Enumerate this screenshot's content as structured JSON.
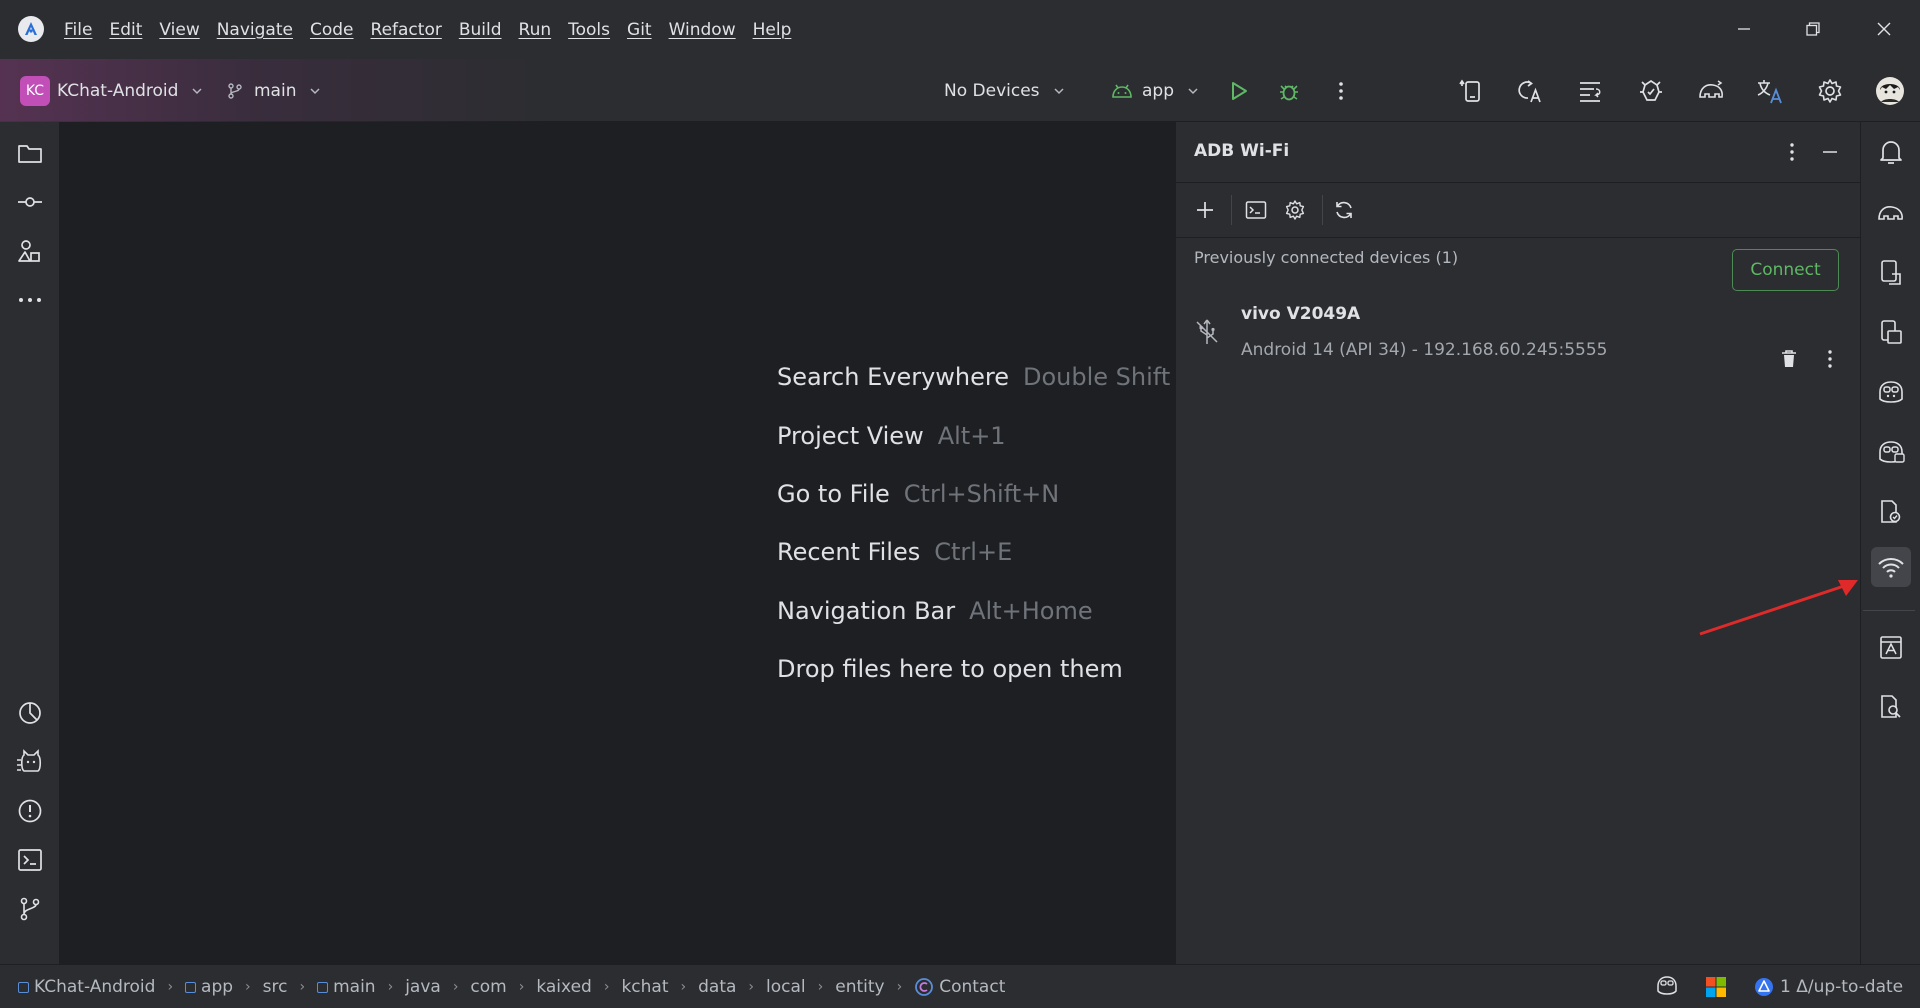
{
  "menu": [
    "File",
    "Edit",
    "View",
    "Navigate",
    "Code",
    "Refactor",
    "Build",
    "Run",
    "Tools",
    "Git",
    "Window",
    "Help"
  ],
  "toolbar": {
    "project_initials": "KC",
    "project_name": "KChat-Android",
    "branch": "main",
    "devices": "No Devices",
    "run_config": "app"
  },
  "editor": {
    "hints": [
      {
        "action": "Search Everywhere",
        "shortcut": "Double Shift"
      },
      {
        "action": "Project View",
        "shortcut": "Alt+1"
      },
      {
        "action": "Go to File",
        "shortcut": "Ctrl+Shift+N"
      },
      {
        "action": "Recent Files",
        "shortcut": "Ctrl+E"
      },
      {
        "action": "Navigation Bar",
        "shortcut": "Alt+Home"
      },
      {
        "action": "Drop files here to open them",
        "shortcut": ""
      }
    ]
  },
  "tool_window": {
    "title": "ADB Wi-Fi",
    "group_header": "Previously connected devices (1)",
    "device": {
      "name": "vivo V2049A",
      "info": "Android 14 (API 34) - 192.168.60.245:5555",
      "connect_label": "Connect"
    }
  },
  "statusbar": {
    "breadcrumb": [
      {
        "label": "KChat-Android",
        "kind": "module"
      },
      {
        "label": "app",
        "kind": "module"
      },
      {
        "label": "src",
        "kind": "folder"
      },
      {
        "label": "main",
        "kind": "module"
      },
      {
        "label": "java",
        "kind": "folder"
      },
      {
        "label": "com",
        "kind": "folder"
      },
      {
        "label": "kaixed",
        "kind": "folder"
      },
      {
        "label": "kchat",
        "kind": "folder"
      },
      {
        "label": "data",
        "kind": "folder"
      },
      {
        "label": "local",
        "kind": "folder"
      },
      {
        "label": "entity",
        "kind": "folder"
      },
      {
        "label": "Contact",
        "kind": "class"
      }
    ],
    "vcs_status": "1 Δ/up-to-date"
  },
  "colors": {
    "accent": "#3574f0",
    "run_green": "#5fb865",
    "annotation_arrow": "#e02a2a",
    "project_badge": "#c24fb8"
  }
}
